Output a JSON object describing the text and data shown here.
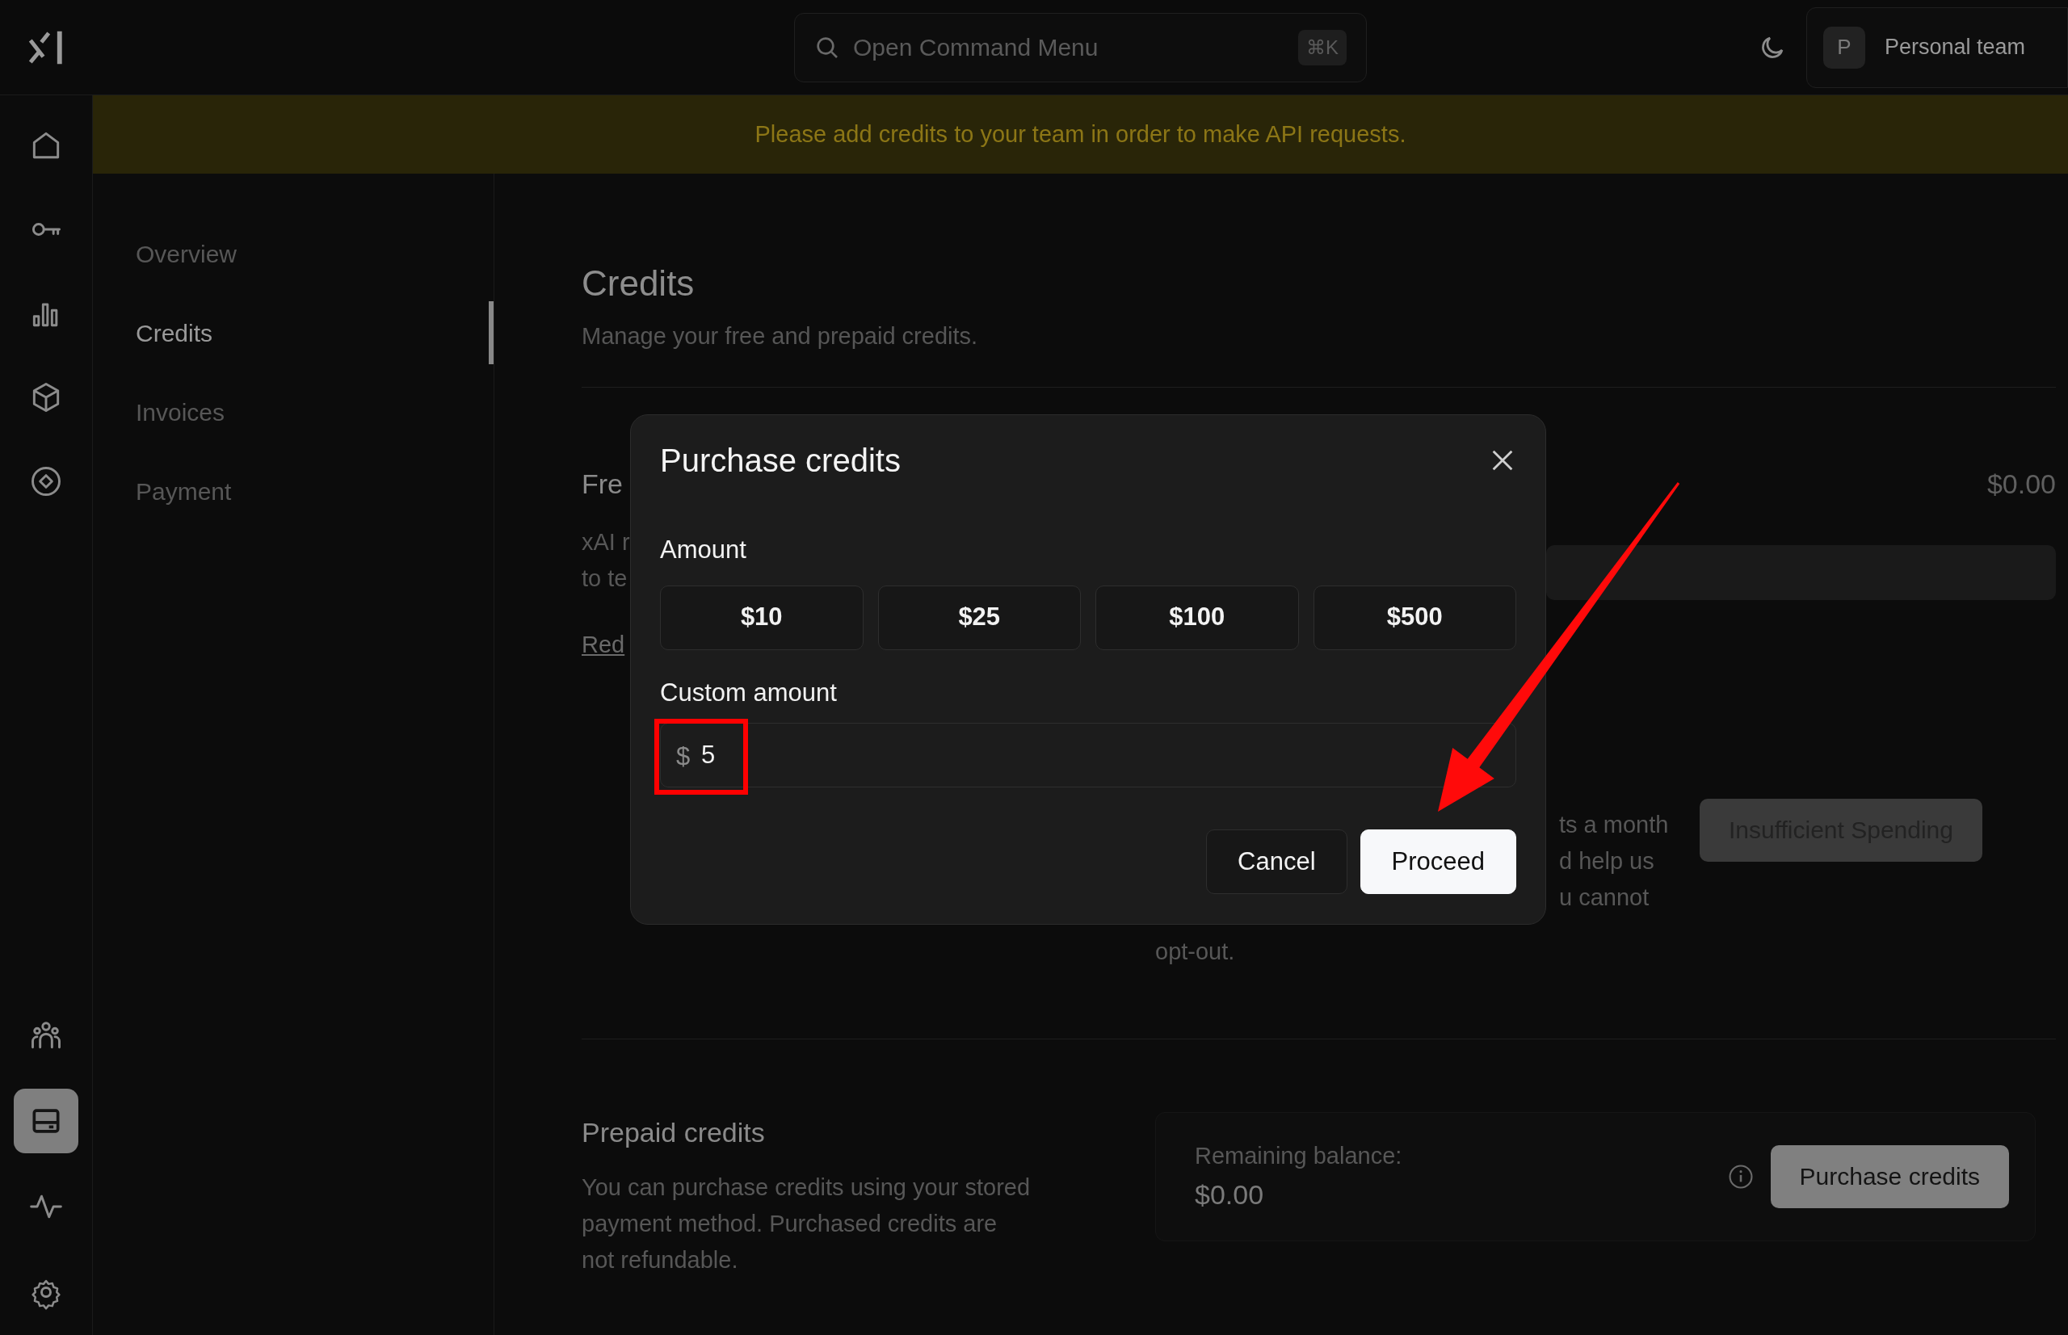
{
  "topbar": {
    "search": {
      "placeholder": "Open Command Menu",
      "shortcut": "⌘K"
    },
    "team": {
      "initial": "P",
      "name": "Personal team"
    }
  },
  "banner": "Please add credits to your team in order to make API requests.",
  "rail": [
    {
      "selected": false
    },
    {
      "selected": false
    },
    {
      "selected": false
    },
    {
      "selected": false
    },
    {
      "selected": false
    },
    {
      "selected": false
    },
    {
      "selected": true
    },
    {
      "selected": false
    },
    {
      "selected": false
    }
  ],
  "subnav": [
    {
      "label": "Overview",
      "selected": false
    },
    {
      "label": "Credits",
      "selected": true
    },
    {
      "label": "Invoices",
      "selected": false
    },
    {
      "label": "Payment",
      "selected": false
    }
  ],
  "page": {
    "title": "Credits",
    "subtitle": "Manage your free and prepaid credits."
  },
  "free_credits": {
    "heading": "Fre",
    "lines": [
      "xAI r",
      "to te"
    ],
    "link": "Red",
    "amount": "$0.00",
    "description_lines": [
      "ts a month",
      "d help us",
      "u cannot",
      "opt-out."
    ],
    "button": {
      "label": "Insufficient Spending",
      "disabled": true
    }
  },
  "prepaid": {
    "heading": "Prepaid credits",
    "text": "You can purchase credits using your stored payment method. Purchased credits are not refundable.",
    "balance_label": "Remaining balance:",
    "balance": "$0.00",
    "button": {
      "label": "Purchase credits",
      "disabled": false
    }
  },
  "dialog": {
    "title": "Purchase credits",
    "amount_label": "Amount",
    "presets": [
      "$10",
      "$25",
      "$100",
      "$500"
    ],
    "custom_label": "Custom amount",
    "custom": {
      "prefix": "$",
      "value": "5"
    },
    "buttons": [
      {
        "label": "Cancel",
        "kind": "secondary"
      },
      {
        "label": "Proceed",
        "kind": "primary"
      }
    ]
  }
}
